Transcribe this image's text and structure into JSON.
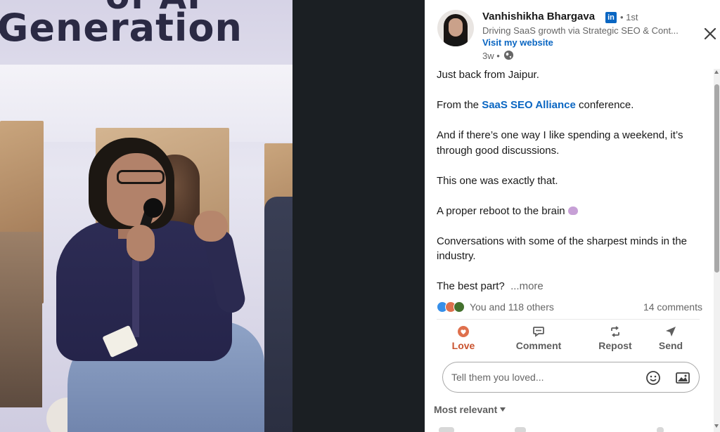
{
  "author": {
    "name": "Vanhishikha Bhargava",
    "degree": "• 1st",
    "headline": "Driving SaaS growth via Strategic SEO & Cont...",
    "website_label": "Visit my website",
    "timestamp": "3w •",
    "linkedin_badge": "in"
  },
  "post": {
    "paragraphs": [
      "Just back from Jaipur.",
      "And if there’s one way I like spending a weekend, it’s through good discussions.",
      "This one was exactly that.",
      "A proper reboot to the brain",
      "Conversations with some of the sharpest minds in the industry.",
      "The best part?"
    ],
    "conference_prefix": "From the",
    "conference_mention": "SaaS SEO Alliance",
    "conference_suffix": "conference.",
    "more_label": "...more"
  },
  "social": {
    "reactions_label": "You and 118 others",
    "comments_label": "14 comments"
  },
  "actions": [
    {
      "label": "Love",
      "icon": "heart-icon"
    },
    {
      "label": "Comment",
      "icon": "comment-icon"
    },
    {
      "label": "Repost",
      "icon": "repost-icon"
    },
    {
      "label": "Send",
      "icon": "send-icon"
    }
  ],
  "comment_input": {
    "placeholder": "Tell them you loved..."
  },
  "sort": {
    "label": "Most relevant"
  },
  "colors": {
    "link_blue": "#0a66c2",
    "love_orange": "#c9532f",
    "dark_backdrop": "#1b1f23"
  }
}
